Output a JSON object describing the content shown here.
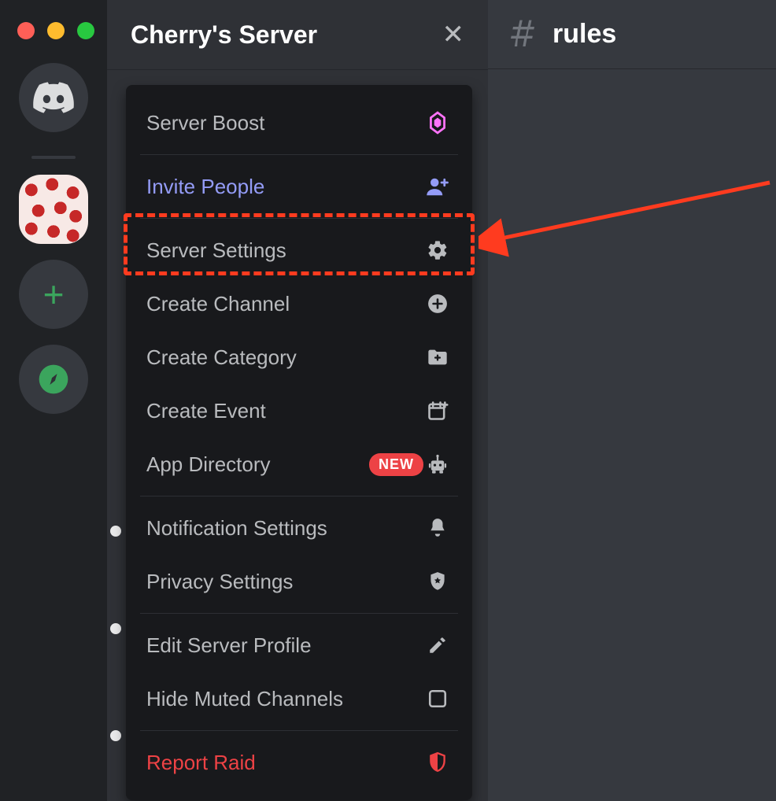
{
  "server": {
    "title": "Cherry's Server"
  },
  "channel": {
    "name": "rules"
  },
  "menu": {
    "boost": "Server Boost",
    "invite": "Invite People",
    "settings": "Server Settings",
    "create_channel": "Create Channel",
    "create_category": "Create Category",
    "create_event": "Create Event",
    "app_directory": "App Directory",
    "app_directory_badge": "NEW",
    "notification": "Notification Settings",
    "privacy": "Privacy Settings",
    "edit_profile": "Edit Server Profile",
    "hide_muted": "Hide Muted Channels",
    "report_raid": "Report Raid"
  },
  "colors": {
    "invite_accent": "#949cf7",
    "danger": "#ed4245",
    "boost_pink": "#ff73fa",
    "annotation_red": "#ff3b1f"
  }
}
